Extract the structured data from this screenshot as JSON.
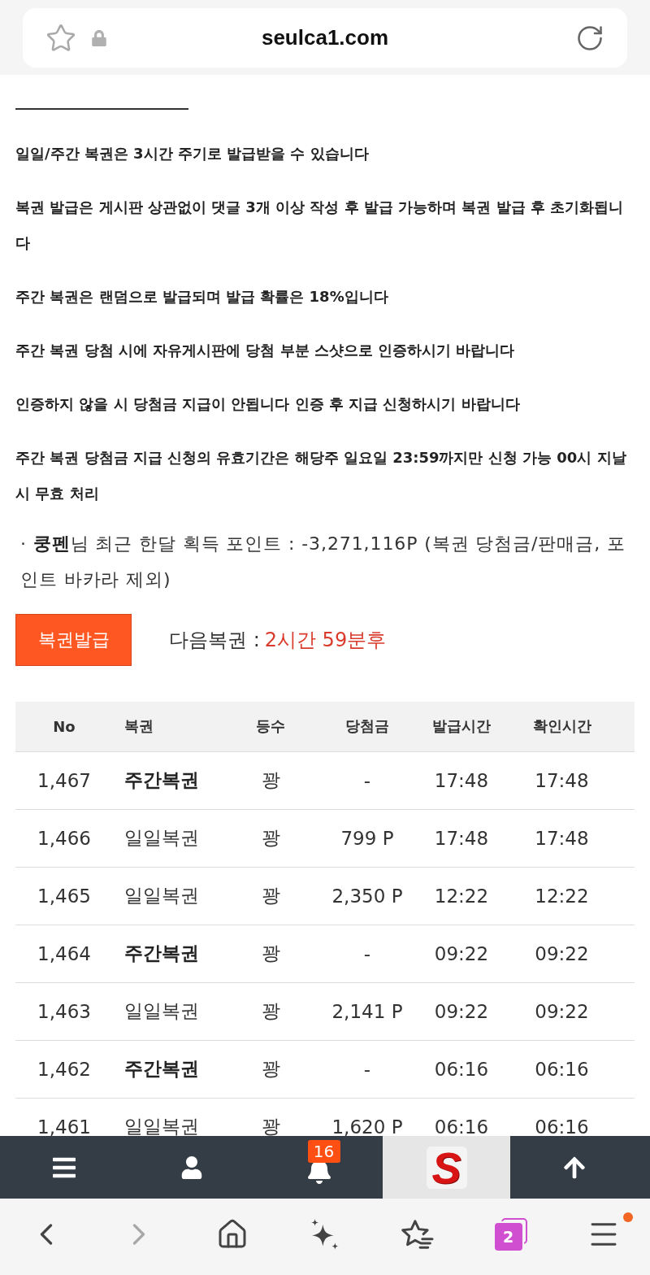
{
  "address_bar": {
    "url": "seulca1.com"
  },
  "page": {
    "notices": [
      "일일/주간 복권은 3시간 주기로 발급받을 수 있습니다",
      "복권 발급은 게시판 상관없이 댓글 3개 이상 작성 후 발급 가능하며 복권 발급 후 초기화됩니다",
      "주간 복권은 랜덤으로 발급되며 발급 확률은 18%입니다",
      "주간 복권 당첨 시에 자유게시판에 당첨 부분 스샷으로 인증하시기 바랍니다",
      "인증하지 않을 시 당첨금 지급이 안됩니다 인증 후 지급 신청하시기 바랍니다",
      "주간 복권 당첨금 지급 신청의 유효기간은 해당주 일요일 23:59까지만 신청 가능 00시 지날 시 무효 처리"
    ],
    "points_summary": "· **쿵펜**님 최근 한달 획득 포인트 : -3,271,116P (복권 당첨금/판매금, 포인트 바카라 제외)",
    "issue_button": "복권발급",
    "next_ticket": {
      "label": "다음복권 :",
      "value": "2시간 59분후"
    }
  },
  "table": {
    "columns": [
      "No",
      "복권",
      "등수",
      "당첨금",
      "발급시간",
      "확인시간"
    ],
    "rows": [
      {
        "kind": "weekly",
        "no": "1,467",
        "ticket": "주간복권",
        "rank": "꽝",
        "prize": "-",
        "issued_time": "17:48",
        "confirmed_time": "17:48"
      },
      {
        "kind": "daily",
        "no": "1,466",
        "ticket": "일일복권",
        "rank": "꽝",
        "prize": "799 P",
        "issued_time": "17:48",
        "confirmed_time": "17:48"
      },
      {
        "kind": "daily",
        "no": "1,465",
        "ticket": "일일복권",
        "rank": "꽝",
        "prize": "2,350 P",
        "issued_time": "12:22",
        "confirmed_time": "12:22"
      },
      {
        "kind": "weekly",
        "no": "1,464",
        "ticket": "주간복권",
        "rank": "꽝",
        "prize": "-",
        "issued_time": "09:22",
        "confirmed_time": "09:22"
      },
      {
        "kind": "daily",
        "no": "1,463",
        "ticket": "일일복권",
        "rank": "꽝",
        "prize": "2,141 P",
        "issued_time": "09:22",
        "confirmed_time": "09:22"
      },
      {
        "kind": "weekly",
        "no": "1,462",
        "ticket": "주간복권",
        "rank": "꽝",
        "prize": "-",
        "issued_time": "06:16",
        "confirmed_time": "06:16"
      },
      {
        "kind": "daily",
        "no": "1,461",
        "ticket": "일일복권",
        "rank": "꽝",
        "prize": "1,620 P",
        "issued_time": "06:16",
        "confirmed_time": "06:16"
      }
    ]
  },
  "site_nav": [
    {
      "kind": "menu"
    },
    {
      "kind": "user"
    },
    {
      "kind": "alerts",
      "badge": "16"
    },
    {
      "kind": "logo",
      "text": "S"
    },
    {
      "kind": "top"
    }
  ],
  "browser_toolbar": [
    {
      "kind": "back",
      "disabled": false,
      "dot": false
    },
    {
      "kind": "forward",
      "disabled": true,
      "dot": false
    },
    {
      "kind": "home",
      "disabled": false,
      "dot": false
    },
    {
      "kind": "assistant",
      "disabled": false,
      "dot": false
    },
    {
      "kind": "bookmarks",
      "disabled": false,
      "dot": false
    },
    {
      "kind": "tabs",
      "disabled": false,
      "dot": false,
      "count": "2"
    },
    {
      "kind": "menu",
      "disabled": false,
      "dot": true
    }
  ]
}
